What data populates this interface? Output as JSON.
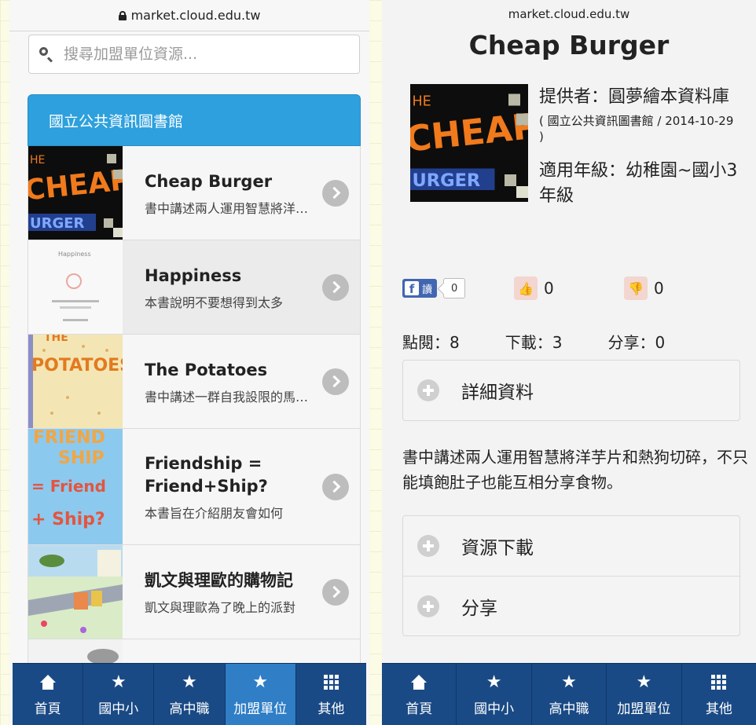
{
  "left": {
    "url": "market.cloud.edu.tw",
    "search_placeholder": "搜尋加盟單位資源...",
    "list_header": "國立公共資訊圖書館",
    "items": [
      {
        "title": "Cheap Burger",
        "desc": "書中講述兩人運用智慧將洋芋片和熱狗切碎"
      },
      {
        "title": "Happiness",
        "desc": "本書說明不要想得到太多"
      },
      {
        "title": "The Potatoes",
        "desc": "書中講述一群自我設限的馬鈴薯"
      },
      {
        "title": "Friendship = Friend+Ship?",
        "desc": "本書旨在介紹朋友會如何"
      },
      {
        "title": "凱文與理歐的購物記",
        "desc": "凱文與理歐為了晚上的派對"
      }
    ]
  },
  "right": {
    "url": "market.cloud.edu.tw",
    "title": "Cheap Burger",
    "provider": "提供者：圓夢繪本資料庫",
    "provider_sub": "( 國立公共資訊圖書館 / 2014-10-29 )",
    "grade": "適用年級：幼稚園~國小3年級",
    "fb_label": "讀",
    "fb_count": "0",
    "like_count": "0",
    "dislike_count": "0",
    "views": "點閱：8",
    "downloads": "下載：3",
    "shares": "分享：0",
    "detail_label": "詳細資料",
    "description": "書中講述兩人運用智慧將洋芋片和熱狗切碎，不只能填飽肚子也能互相分享食物。",
    "download_label": "資源下載",
    "share_label": "分享"
  },
  "tabs": [
    {
      "label": "首頁",
      "icon": "home-icon"
    },
    {
      "label": "國中小",
      "icon": "star-icon"
    },
    {
      "label": "高中職",
      "icon": "star-icon"
    },
    {
      "label": "加盟單位",
      "icon": "star-icon"
    },
    {
      "label": "其他",
      "icon": "grid-icon"
    }
  ],
  "colors": {
    "header_blue": "#2ea0dd",
    "tabbar": "#1a4a85",
    "tab_active": "#2f7ec6"
  }
}
